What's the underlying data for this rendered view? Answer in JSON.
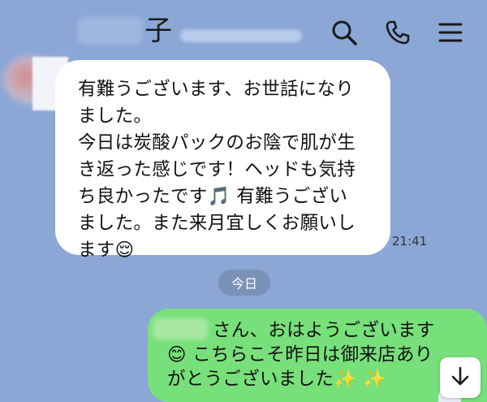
{
  "header": {
    "contact_name_visible_part": "子",
    "icons": [
      "search-icon",
      "phone-icon",
      "menu-icon"
    ]
  },
  "messages": {
    "incoming": {
      "text": "有難うございます、お世話になり\nました。\n今日は炭酸パックのお陰で肌が生\nき返った感じです！ヘッドも気持\nち良かったです🎵 有難うござい\nました。また来月宜しくお願いし\nます😌",
      "time": "21:41"
    },
    "date_separator": "今日",
    "outgoing": {
      "text": "さん、おはようございます\n😊 こちらこそ昨日は御来店あり\nがとうございました✨ ✨"
    }
  },
  "colors": {
    "background": "#8aa7d6",
    "incoming_bubble": "#ffffff",
    "outgoing_bubble": "#77e07a"
  },
  "controls": {
    "scroll_down_icon": "arrow-down-icon"
  }
}
